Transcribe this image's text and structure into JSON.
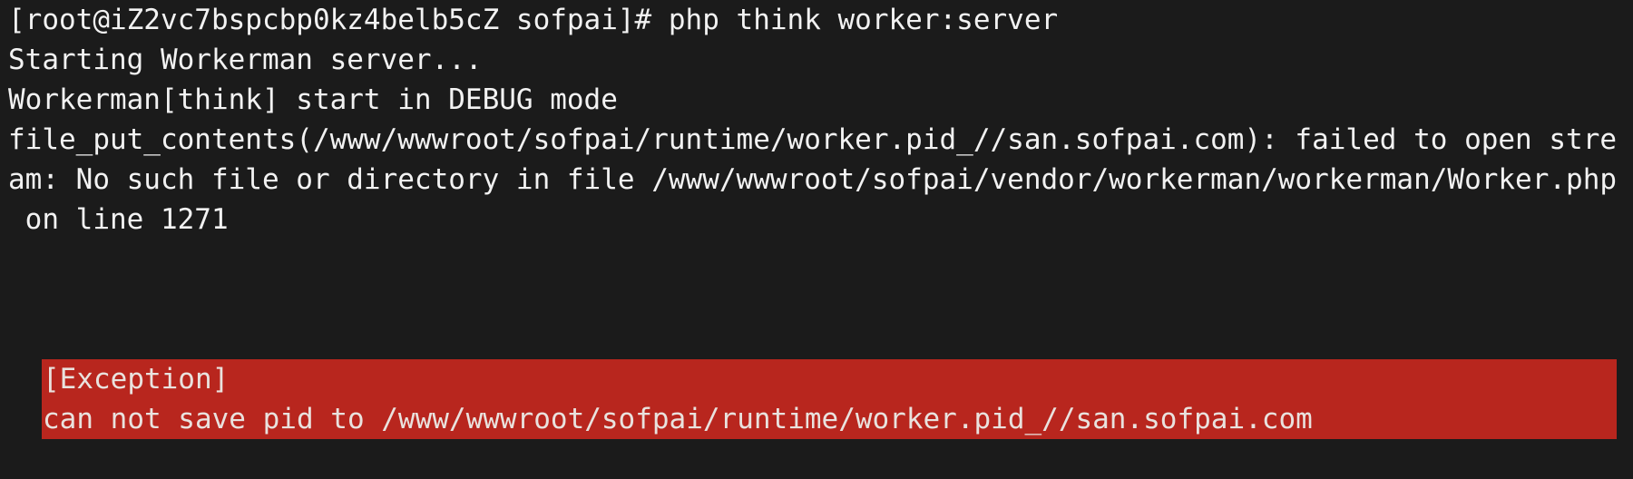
{
  "terminal": {
    "lines": [
      "[root@iZ2vc7bspcbp0kz4belb5cZ sofpai]# php think worker:server",
      "Starting Workerman server...",
      "Workerman[think] start in DEBUG mode",
      "file_put_contents(/www/wwwroot/sofpai/runtime/worker.pid_//san.sofpai.com): failed to open stre",
      "am: No such file or directory in file /www/wwwroot/sofpai/vendor/workerman/workerman/Worker.php",
      " on line 1271"
    ],
    "exception": {
      "title": "[Exception]",
      "message": "can not save pid to /www/wwwroot/sofpai/runtime/worker.pid_//san.sofpai.com"
    }
  },
  "colors": {
    "background": "#1b1b1b",
    "text": "#f2f2f2",
    "exception_background": "#b8261e",
    "exception_text": "#e9e2de"
  }
}
